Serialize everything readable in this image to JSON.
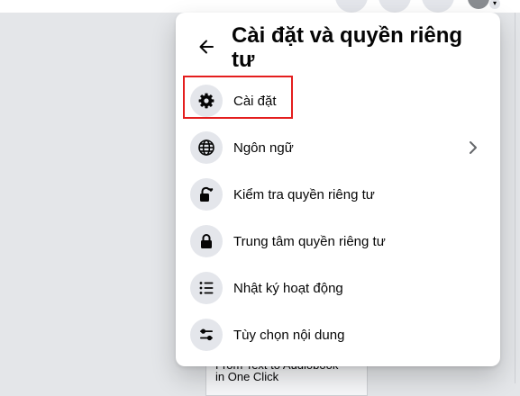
{
  "panel": {
    "title": "Cài đặt và quyền riêng tư",
    "items": [
      {
        "label": "Cài đặt",
        "icon": "gear-icon"
      },
      {
        "label": "Ngôn ngữ",
        "icon": "globe-icon",
        "has_submenu": true
      },
      {
        "label": "Kiểm tra quyền riêng tư",
        "icon": "lock-heart-icon"
      },
      {
        "label": "Trung tâm quyền riêng tư",
        "icon": "lock-icon"
      },
      {
        "label": "Nhật ký hoạt động",
        "icon": "list-icon"
      },
      {
        "label": "Tùy chọn nội dung",
        "icon": "sliders-icon"
      }
    ]
  },
  "background_card": {
    "line1": "From Text to Audiobook",
    "line2": "in One Click"
  },
  "colors": {
    "highlight": "#e41e1e",
    "icon_bg": "#e4e6eb",
    "page_bg": "#e4e6e9"
  }
}
